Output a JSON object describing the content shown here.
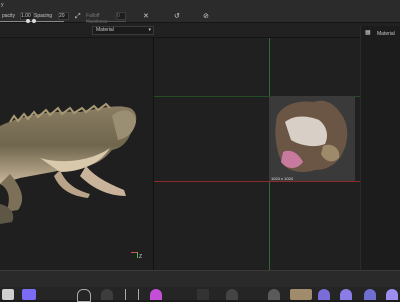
{
  "toolbar": {
    "app_fragment": "y",
    "opacity_label": "pacity",
    "opacity_value": "1.00",
    "spacing_label": "Spacing",
    "spacing_value": "20",
    "falloff_label": "Falloff",
    "falloff_value": "0",
    "hardness_label": "Hardness"
  },
  "subbar": {
    "material_dropdown": "Material"
  },
  "right_panel": {
    "material_label": "Material"
  },
  "viewport_right": {
    "thumbnail_caption": "1024 x 1024"
  },
  "axis_gizmo": {
    "z_label": "Z"
  },
  "colors": {
    "background": "#1b1b1b",
    "toolbar": "#2b2b2b",
    "accent_green": "#2e6b2e",
    "accent_red": "#8a2a2a",
    "shelf_purple": "#7b6cf5"
  },
  "icons": [
    "picker-icon",
    "close-icon",
    "reset-icon",
    "link-icon",
    "layout-icon",
    "axis-gizmo-icon"
  ]
}
